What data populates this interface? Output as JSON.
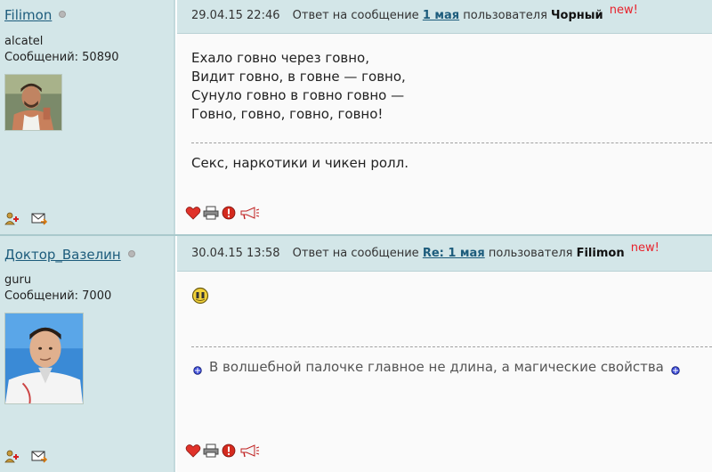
{
  "posts": [
    {
      "author": "Filimon",
      "rank": "alcatel",
      "messages": "Сообщений: 50890",
      "date": "29.04.15 22:46",
      "reply_prefix": "Ответ на сообщение",
      "reply_link": "1 мая",
      "reply_by": "пользователя",
      "reply_user": "Чорный",
      "new_label": "new!",
      "body_lines": [
        "Ехало говно через говно,",
        "Видит говно, в говне — говно,",
        "Сунуло говно в говно говно —",
        "Говно, говно, говно, говно!"
      ],
      "signature": "Секс, наркотики и чикен ролл."
    },
    {
      "author": "Доктор_Вазелин",
      "rank": "guru",
      "messages": "Сообщений: 7000",
      "date": "30.04.15 13:58",
      "reply_prefix": "Ответ на сообщение",
      "reply_link": "Re: 1 мая",
      "reply_by": "пользователя",
      "reply_user": "Filimon",
      "new_label": "new!",
      "signature": "В волшебной палочке главное не длина, а магические свойства"
    }
  ],
  "colors": {
    "panel_bg": "#d3e6e8",
    "link": "#1d5c7c",
    "new_badge": "#e8212b",
    "body_bg": "#fafafa"
  },
  "icons": [
    "add-contact-icon",
    "send-message-icon",
    "heart-icon",
    "print-icon",
    "report-icon",
    "megaphone-icon",
    "smiley-icon",
    "bullet-icon"
  ]
}
